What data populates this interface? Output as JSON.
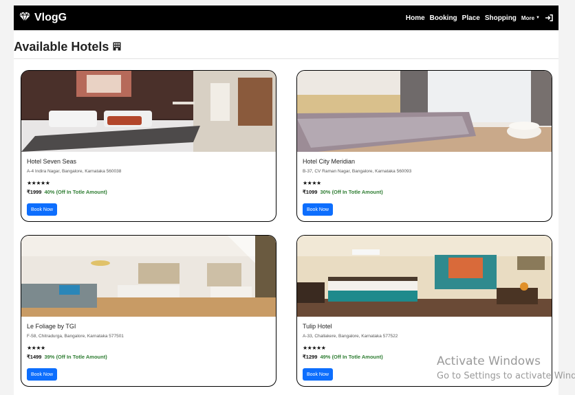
{
  "navbar": {
    "brand": "VlogG",
    "links": [
      "Home",
      "Booking",
      "Place",
      "Shopping"
    ],
    "more_label": "More"
  },
  "page": {
    "heading": "Available Hotels"
  },
  "hotels": [
    {
      "name": "Hotel Seven Seas",
      "address": "A-4 Indira Nagar, Bangalore, Karnataka 560038",
      "stars": "★★★★★",
      "price": "₹1999",
      "discount": "40% (Off In Totle Amount)",
      "button": "Book Now"
    },
    {
      "name": "Hotel City Meridian",
      "address": "B-37, CV Raman Nagar, Bangalore, Karnataka 560093",
      "stars": "★★★★",
      "price": "₹1099",
      "discount": "30% (Off In Totle Amount)",
      "button": "Book Now"
    },
    {
      "name": "Le Foliage by TGI",
      "address": "F-58, Chitradurga, Bangalore, Karnataka 577501",
      "stars": "★★★★",
      "price": "₹1499",
      "discount": "39% (Off In Totle Amount)",
      "button": "Book Now"
    },
    {
      "name": "Tulip Hotel",
      "address": "A-33, Challakere, Bangalore, Karnataka 577522",
      "stars": "★★★★★",
      "price": "₹1299",
      "discount": "49% (Off In Totle Amount)",
      "button": "Book Now"
    }
  ],
  "watermark": {
    "title": "Activate Windows",
    "subtitle": "Go to Settings to activate Windows."
  },
  "colors": {
    "navbar_bg": "#000000",
    "button_bg": "#0d6efd",
    "discount_text": "#2e7d32"
  },
  "icons": {
    "brand": "gem-icon",
    "heading": "hotel-building-icon",
    "more": "caret-down-icon",
    "login": "login-icon"
  }
}
